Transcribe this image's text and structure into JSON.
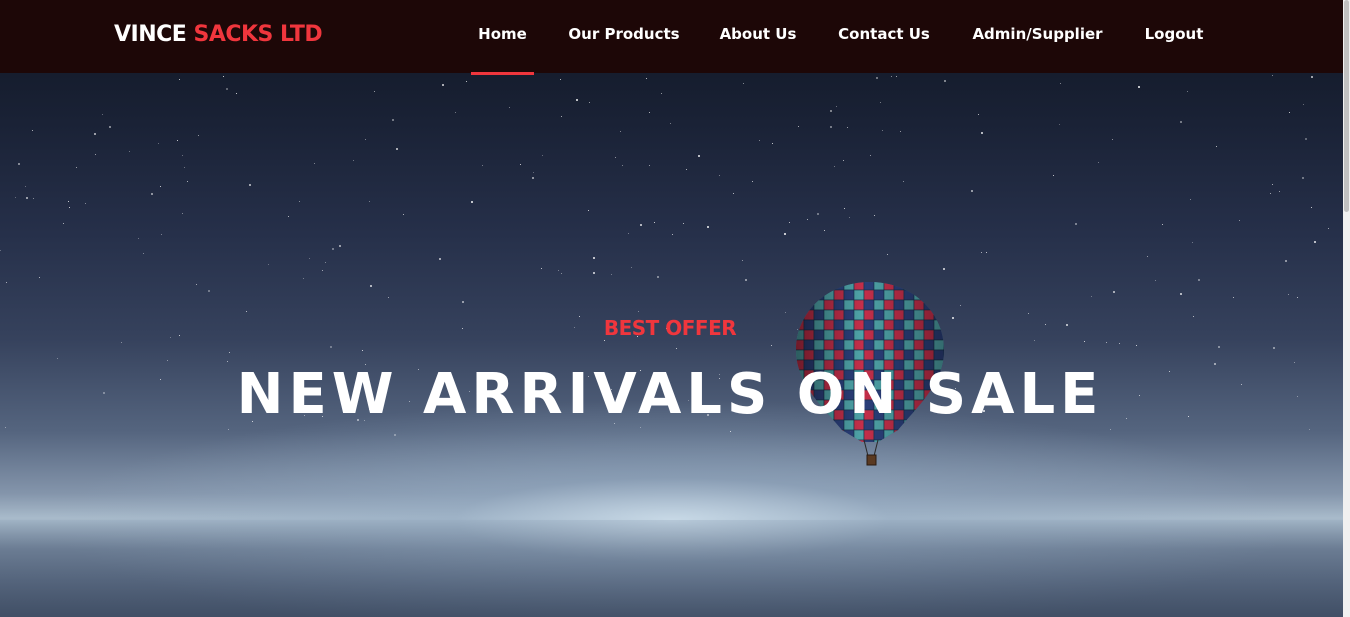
{
  "brand": {
    "part1": "VINCE",
    "part2": "SACKS LTD"
  },
  "nav": {
    "items": [
      {
        "label": "Home",
        "active": true
      },
      {
        "label": "Our Products",
        "active": false
      },
      {
        "label": "About Us",
        "active": false
      },
      {
        "label": "Contact Us",
        "active": false
      },
      {
        "label": "Admin/Supplier",
        "active": false
      },
      {
        "label": "Logout",
        "active": false
      }
    ]
  },
  "hero": {
    "eyebrow": "BEST OFFER",
    "headline": "NEW ARRIVALS ON SALE"
  },
  "colors": {
    "accent": "#f0363d",
    "header_bg": "#1d0707",
    "text": "#ffffff"
  },
  "icons": {
    "hero_image": "hot-air-balloon-over-water"
  }
}
